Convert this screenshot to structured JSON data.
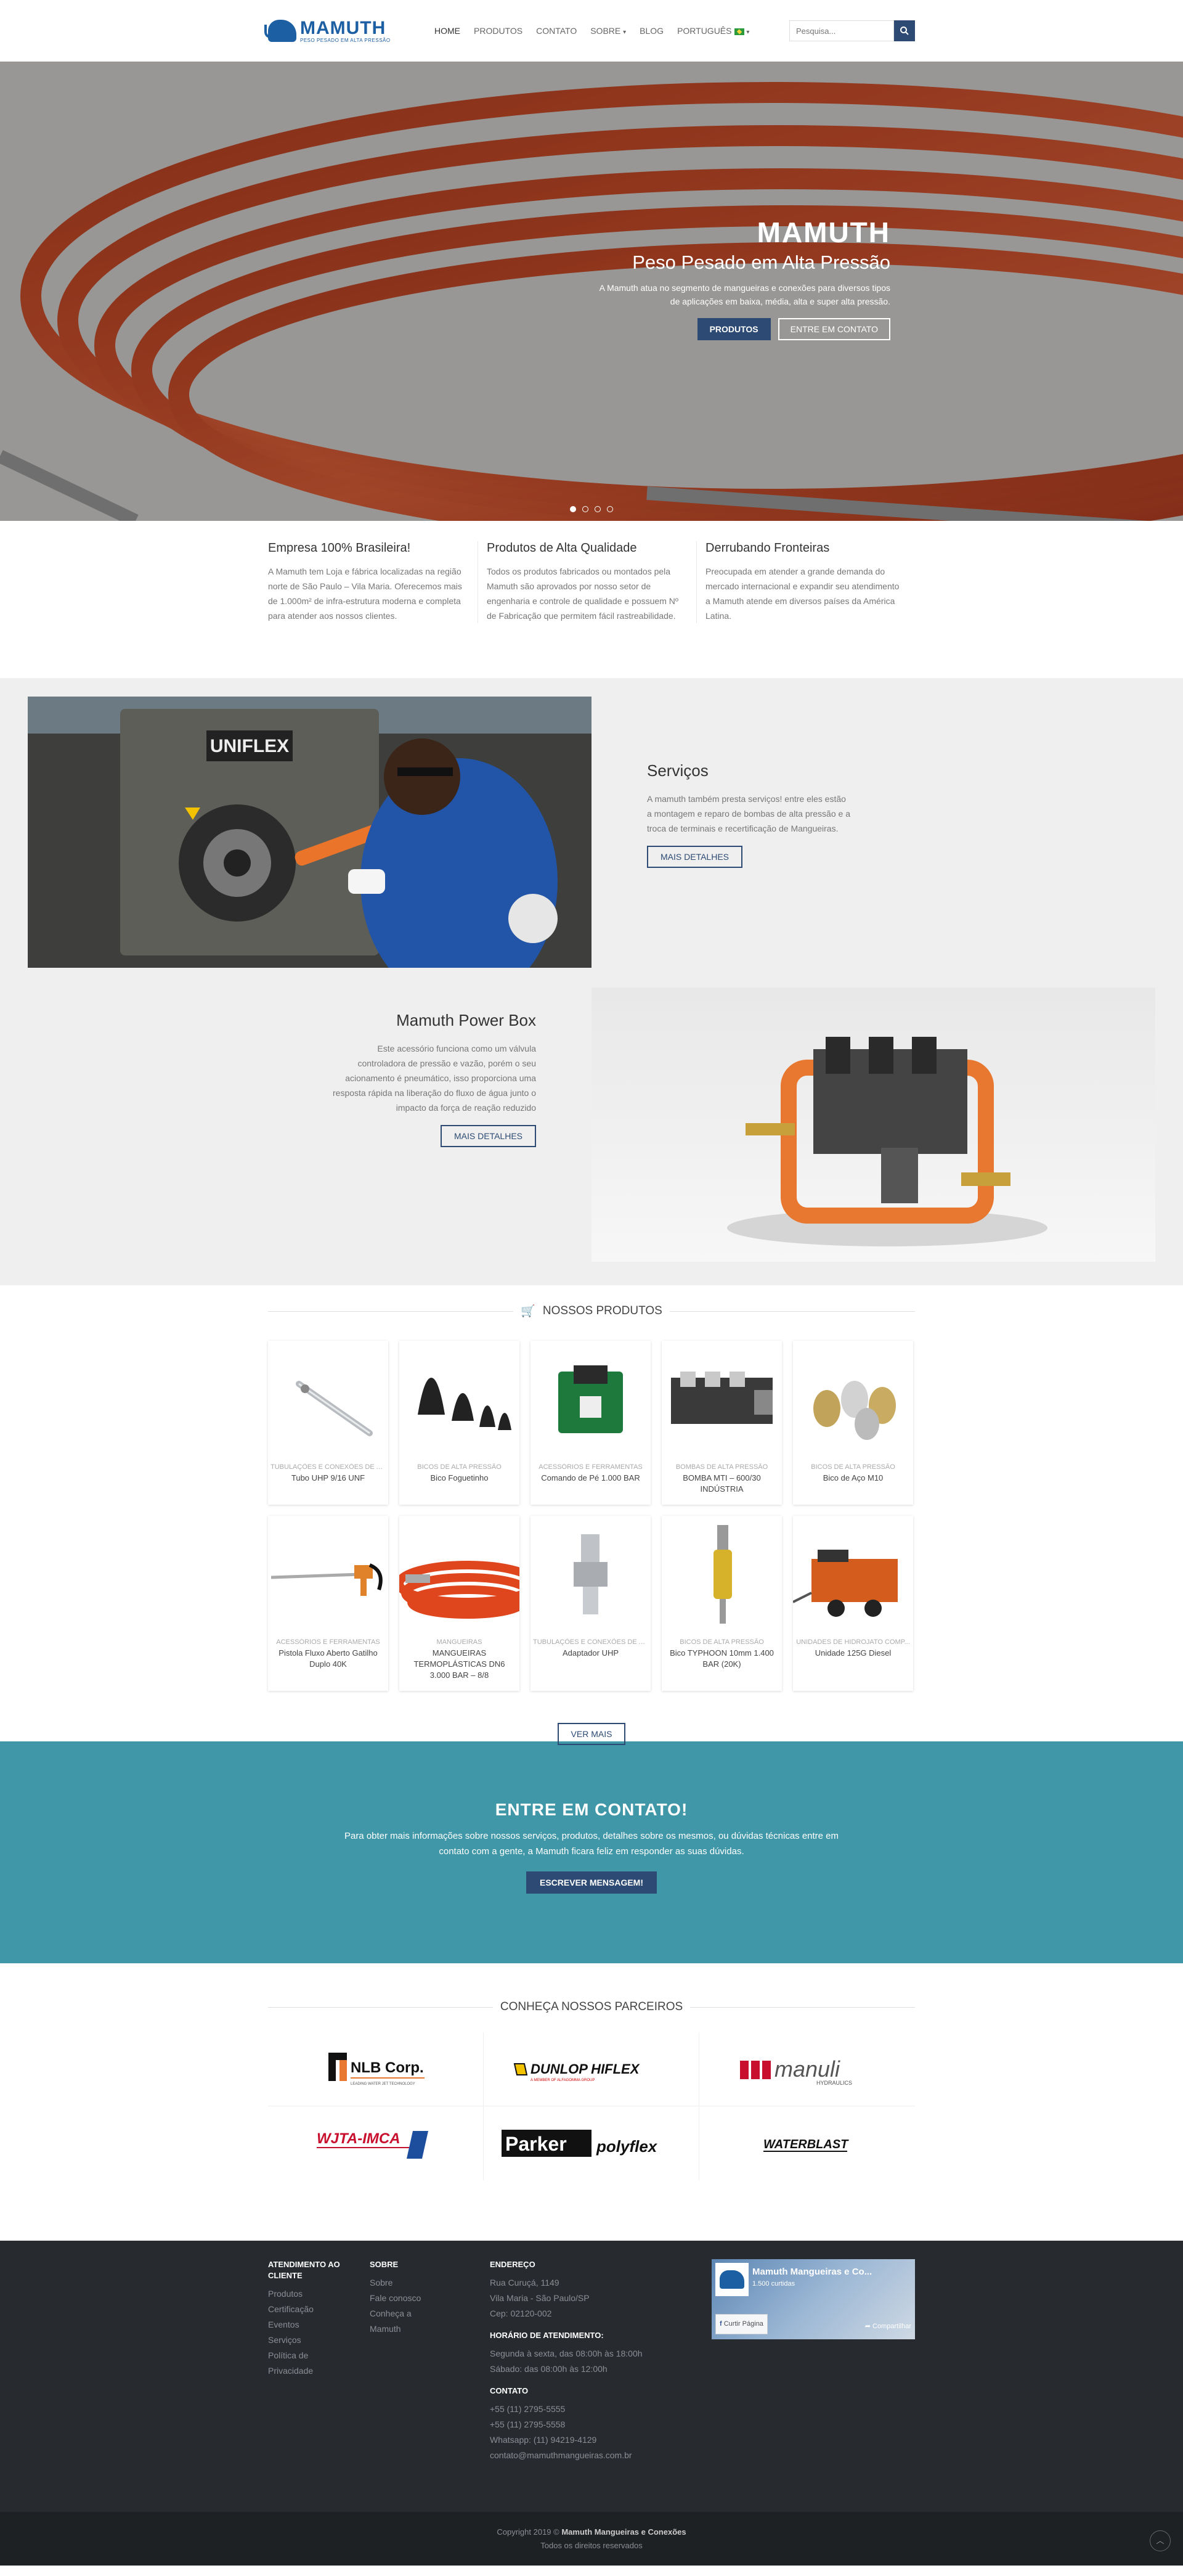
{
  "header": {
    "logo_name": "MAMUTH",
    "logo_tagline": "PESO PESADO EM ALTA PRESSÃO",
    "nav": [
      "HOME",
      "PRODUTOS",
      "CONTATO",
      "SOBRE",
      "BLOG",
      "PORTUGUÊS"
    ],
    "search_placeholder": "Pesquisa..."
  },
  "hero": {
    "title": "MAMUTH",
    "subtitle": "Peso Pesado em Alta Pressão",
    "description": "A Mamuth atua no segmento de mangueiras e conexões para diversos tipos de aplicações em baixa, média, alta e super alta pressão.",
    "btn_products": "PRODUTOS",
    "btn_contact": "ENTRE EM CONTATO",
    "slide_count": 4,
    "active_slide": 1
  },
  "features": [
    {
      "title": "Empresa 100% Brasileira!",
      "text": "A Mamuth tem Loja e fábrica localizadas na região norte de São Paulo – Vila Maria. Oferecemos mais de 1.000m² de infra-estrutura moderna e completa para atender aos nossos clientes."
    },
    {
      "title": "Produtos de Alta Qualidade",
      "text": "Todos os produtos fabricados ou montados pela Mamuth são aprovados por nosso setor de engenharia e controle de qualidade e possuem Nº de Fabricação que permitem fácil rastreabilidade."
    },
    {
      "title": "Derrubando Fronteiras",
      "text": "Preocupada em atender a grande demanda do mercado internacional e expandir seu atendimento a Mamuth atende em diversos países da América Latina."
    }
  ],
  "services": {
    "title": "Serviços",
    "text": "A mamuth também presta serviços! entre eles estão a montagem e reparo de bombas de alta pressão e a troca de terminais e recertificação de Mangueiras.",
    "button": "MAIS DETALHES",
    "image_text": "UNIFLEX"
  },
  "powerbox": {
    "title": "Mamuth Power Box",
    "text": "Este acessório funciona como um válvula controladora de pressão e vazão, porém o seu acionamento é pneumático, isso proporciona uma resposta rápida na liberação do fluxo de água junto o impacto da força de reação reduzido",
    "button": "MAIS DETALHES"
  },
  "products": {
    "title": "NOSSOS PRODUTOS",
    "items": [
      {
        "category": "TUBULAÇÕES E CONEXÕES DE AL...",
        "name": "Tubo UHP 9/16 UNF",
        "kind": "tube"
      },
      {
        "category": "BICOS DE ALTA PRESSÃO",
        "name": "Bico Foguetinho",
        "kind": "nozzles-black"
      },
      {
        "category": "ACESSÓRIOS E FERRAMENTAS",
        "name": "Comando de Pé 1.000 BAR",
        "kind": "pedal"
      },
      {
        "category": "BOMBAS DE ALTA PRESSÃO",
        "name": "BOMBA MTI – 600/30 INDÚSTRIA",
        "kind": "pump"
      },
      {
        "category": "BICOS DE ALTA PRESSÃO",
        "name": "Bico de Aço M10",
        "kind": "nozzles-steel"
      },
      {
        "category": "ACESSÓRIOS E FERRAMENTAS",
        "name": "Pistola Fluxo Aberto Gatilho Duplo 40K",
        "kind": "gun"
      },
      {
        "category": "MANGUEIRAS",
        "name": "MANGUEIRAS TERMOPLÁSTICAS DN6 3.000 BAR – 8/8",
        "kind": "hose"
      },
      {
        "category": "TUBULAÇÕES E CONEXÕES DE AL...",
        "name": "Adaptador UHP",
        "kind": "adapter"
      },
      {
        "category": "BICOS DE ALTA PRESSÃO",
        "name": "Bico TYPHOON 10mm 1.400 BAR (20K)",
        "kind": "typhoon"
      },
      {
        "category": "UNIDADES DE HIDROJATO COMP...",
        "name": "Unidade 125G Diesel",
        "kind": "trailer"
      }
    ],
    "more_button": "VER MAIS"
  },
  "contact": {
    "title": "ENTRE EM CONTATO!",
    "text": "Para obter mais informações sobre nossos serviços, produtos, detalhes sobre os mesmos, ou dúvidas técnicas entre em contato com a gente, a Mamuth ficara feliz em responder as suas dúvidas.",
    "button": "ESCREVER MENSAGEM!"
  },
  "partners": {
    "title": "CONHEÇA NOSSOS PARCEIROS",
    "logos": [
      "NLB Corp.",
      "DUNLOP HIFLEX",
      "manuli",
      "WJTA-IMCA",
      "Parker polyflex",
      "WATERBLAST"
    ],
    "logo_sub": {
      "nlb": "LEADING WATER JET TECHNOLOGY",
      "manuli": "HYDRAULICS",
      "dunlop": "A MEMBER OF ALFAGOMMA GROUP"
    }
  },
  "footer": {
    "col1_title": "ATENDIMENTO AO CLIENTE",
    "col1_items": [
      "Produtos",
      "Certificação",
      "Eventos",
      "Serviços",
      "Política de Privacidade"
    ],
    "col2_title": "SOBRE",
    "col2_items": [
      "Sobre",
      "Fale conosco",
      "Conheça a Mamuth"
    ],
    "address_title": "ENDEREÇO",
    "address_lines": [
      "Rua Curuçá, 1149",
      "Vila Maria - São Paulo/SP",
      "Cep: 02120-002"
    ],
    "hours_title": "HORÁRIO DE ATENDIMENTO:",
    "hours_lines": [
      "Segunda à sexta, das 08:00h às 18:00h",
      "Sábado: das 08:00h às 12:00h"
    ],
    "contact_title": "CONTATO",
    "contact_lines": [
      "+55 (11) 2795-5555",
      "+55 (11) 2795-5558",
      "Whatsapp: (11) 94219-4129",
      "contato@mamuthmangueiras.com.br"
    ],
    "fb_name": "Mamuth Mangueiras e Co...",
    "fb_likes": "1.500 curtidas",
    "fb_like_btn": "Curtir Página",
    "fb_share_btn": "Compartilhar"
  },
  "copyright": {
    "line1_prefix": "Copyright 2019 ©",
    "company": "Mamuth Mangueiras e Conexões",
    "line2": "Todos os direitos reservados"
  },
  "colors": {
    "primary": "#2c4a73",
    "contact_bg": "#3f97a7",
    "footer_bg": "#272b30",
    "logo_blue": "#1d5fa3"
  }
}
